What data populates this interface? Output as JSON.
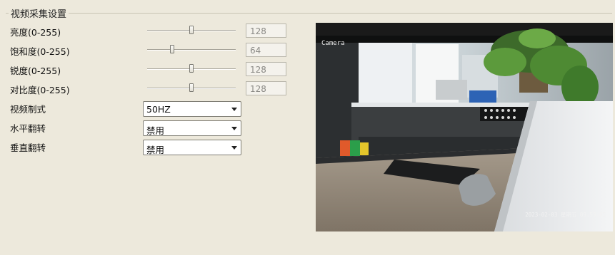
{
  "group": {
    "title": "视频采集设置"
  },
  "sliders": [
    {
      "label": "亮度(0-255)",
      "value": "128",
      "fraction": 0.5
    },
    {
      "label": "饱和度(0-255)",
      "value": "64",
      "fraction": 0.25
    },
    {
      "label": "锐度(0-255)",
      "value": "128",
      "fraction": 0.5
    },
    {
      "label": "对比度(0-255)",
      "value": "128",
      "fraction": 0.5
    }
  ],
  "selects": [
    {
      "label": "视频制式",
      "value": "50HZ"
    },
    {
      "label": "水平翻转",
      "value": "禁用"
    },
    {
      "label": "垂直翻转",
      "value": "禁用"
    }
  ],
  "preview": {
    "camera_label": "Camera",
    "timestamp": "2023-02-03 星期五 09:59:05"
  }
}
